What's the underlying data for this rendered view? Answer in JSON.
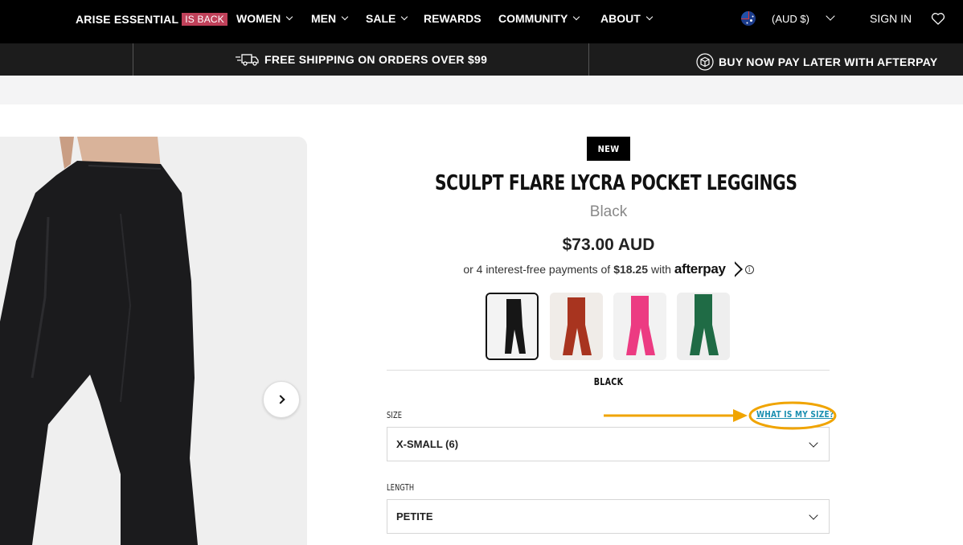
{
  "nav": {
    "brand": "ARISE ESSENTIAL",
    "brand_badge": "IS BACK",
    "links": [
      "WOMEN",
      "MEN",
      "SALE",
      "REWARDS",
      "COMMUNITY",
      "ABOUT"
    ],
    "currency": "(AUD $)",
    "sign_in": "SIGN IN"
  },
  "promo": {
    "shipping": "FREE SHIPPING ON ORDERS OVER $99",
    "afterpay": "BUY NOW PAY LATER WITH AFTERPAY"
  },
  "product": {
    "badge": "NEW",
    "title": "SCULPT FLARE LYCRA POCKET LEGGINGS",
    "color": "Black",
    "price": "$73.00 AUD",
    "installment_prefix": "or 4 interest-free payments of",
    "installment_amount": "$18.25",
    "installment_with": "with",
    "afterpay_brand": "afterpay",
    "swatches": [
      {
        "color": "#161616",
        "bg": "#f3f3f3"
      },
      {
        "color": "#a8341f",
        "bg": "#f0ece8"
      },
      {
        "color": "#ec3b82",
        "bg": "#f2f2f2"
      },
      {
        "color": "#1f6b45",
        "bg": "#eeeeee"
      }
    ],
    "selected_color_label": "BLACK",
    "size_label": "SIZE",
    "size_value": "X-SMALL (6)",
    "size_guide_link": "WHAT IS MY SIZE?",
    "length_label": "LENGTH",
    "length_value": "PETITE"
  },
  "colors": {
    "accent_link": "#1a8fb0",
    "annotation": "#f0a400",
    "badge": "#c0415a"
  }
}
